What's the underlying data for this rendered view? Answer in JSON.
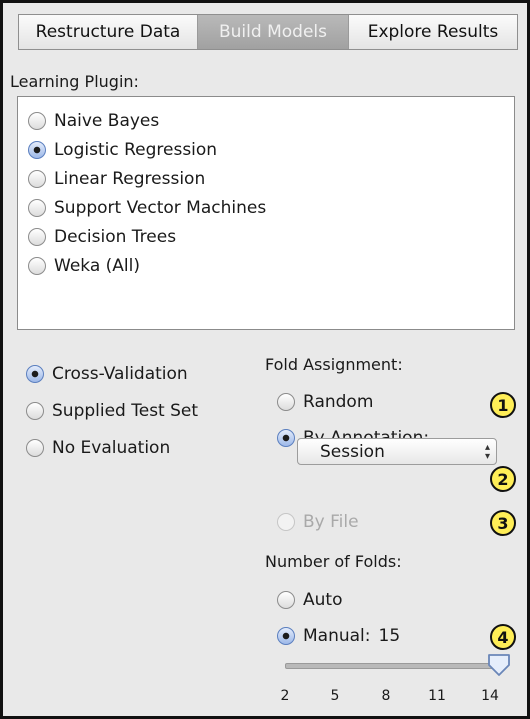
{
  "tabs": [
    {
      "label": "Restructure Data",
      "active": false
    },
    {
      "label": "Build Models",
      "active": true
    },
    {
      "label": "Explore Results",
      "active": false
    }
  ],
  "plugin": {
    "heading": "Learning Plugin:",
    "options": [
      {
        "label": "Naive Bayes",
        "selected": false
      },
      {
        "label": "Logistic Regression",
        "selected": true
      },
      {
        "label": "Linear Regression",
        "selected": false
      },
      {
        "label": "Support Vector Machines",
        "selected": false
      },
      {
        "label": "Decision Trees",
        "selected": false
      },
      {
        "label": "Weka (All)",
        "selected": false
      }
    ]
  },
  "evaluation": {
    "options": [
      {
        "label": "Cross-Validation",
        "selected": true
      },
      {
        "label": "Supplied Test Set",
        "selected": false
      },
      {
        "label": "No Evaluation",
        "selected": false
      }
    ]
  },
  "fold_assignment": {
    "heading": "Fold Assignment:",
    "random_label": "Random",
    "by_annotation_label": "By Annotation:",
    "annotation_value": "Session",
    "by_file_label": "By File"
  },
  "folds": {
    "heading": "Number of Folds:",
    "auto_label": "Auto",
    "manual_label": "Manual:",
    "manual_value": "15",
    "slider_ticks": [
      "2",
      "5",
      "8",
      "11",
      "14"
    ],
    "slider_value": 15
  },
  "callouts": [
    "1",
    "2",
    "3",
    "4"
  ],
  "colors": {
    "callout": "#ffee57",
    "radio_selected": "#9db8e8"
  }
}
